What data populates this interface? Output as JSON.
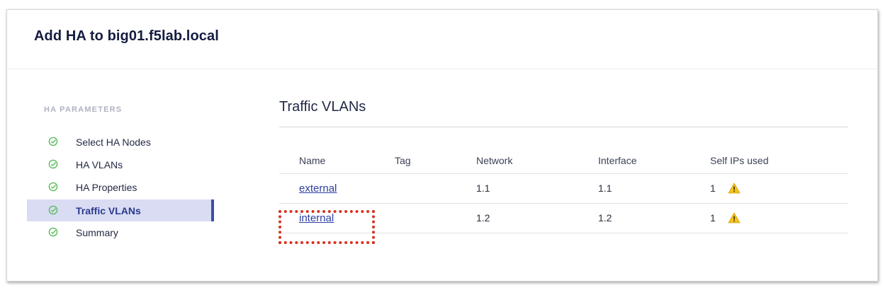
{
  "page": {
    "title": "Add HA to big01.f5lab.local"
  },
  "sidebar": {
    "heading": "HA PARAMETERS",
    "items": [
      {
        "label": "Select HA Nodes",
        "icon": "check-circle-icon",
        "active": false
      },
      {
        "label": "HA VLANs",
        "icon": "check-circle-icon",
        "active": false
      },
      {
        "label": "HA Properties",
        "icon": "check-circle-icon",
        "active": false
      },
      {
        "label": "Traffic VLANs",
        "icon": "check-circle-icon",
        "active": true
      },
      {
        "label": "Summary",
        "icon": "check-circle-icon",
        "active": false
      }
    ]
  },
  "main": {
    "section_title": "Traffic VLANs",
    "table": {
      "columns": [
        "Name",
        "Tag",
        "Network",
        "Interface",
        "Self IPs used"
      ],
      "rows": [
        {
          "name": "external",
          "tag": "",
          "network": "1.1",
          "interface": "1.1",
          "self_ips_used": "1",
          "warning_icon": "warning-icon"
        },
        {
          "name": "internal",
          "tag": "",
          "network": "1.2",
          "interface": "1.2",
          "self_ips_used": "1",
          "warning_icon": "warning-icon"
        }
      ]
    }
  },
  "colors": {
    "title": "#141c3f",
    "active_bg": "#d9dcf3",
    "active_bar": "#3d4fa8",
    "link": "#2c3fa3",
    "check": "#5cbc5c",
    "warning": "#f4c21b",
    "highlight": "#d9301e"
  }
}
